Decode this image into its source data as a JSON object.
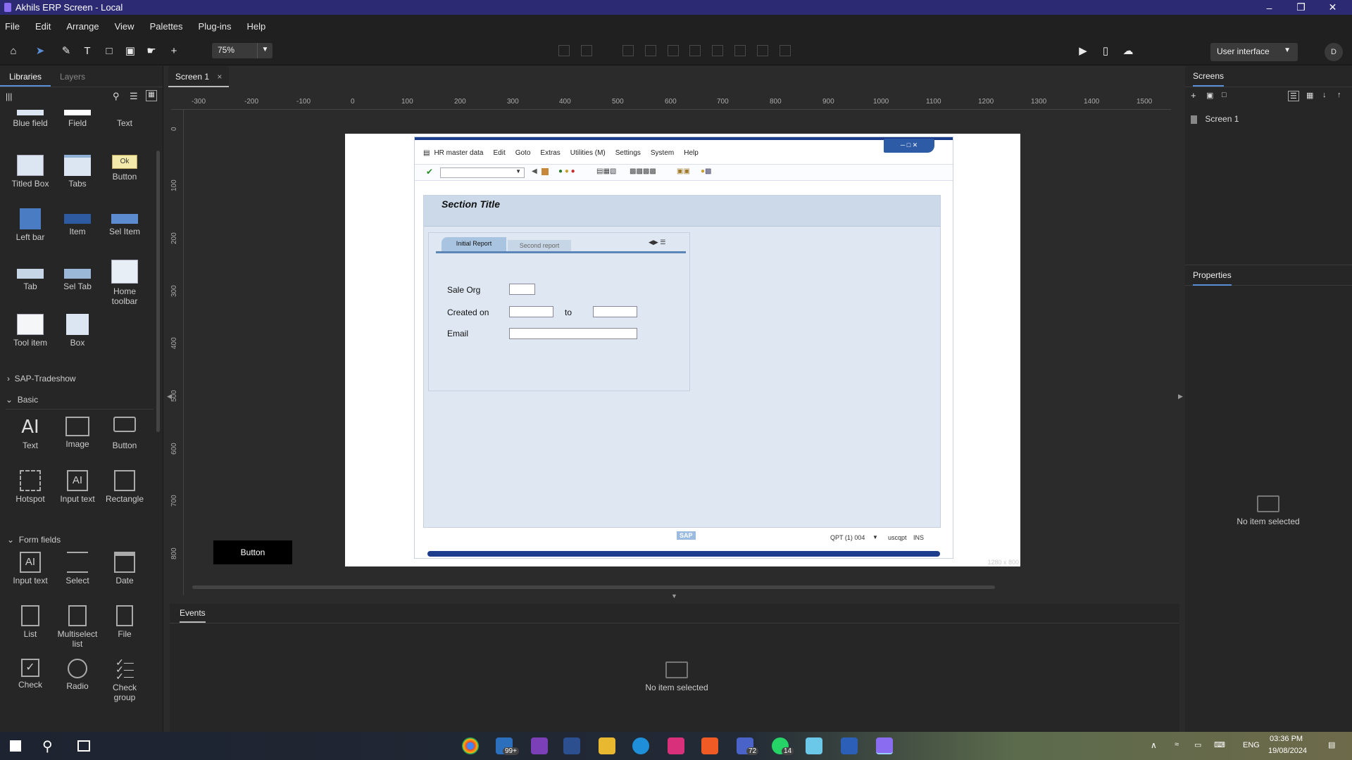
{
  "window": {
    "title": "Akhils ERP Screen - Local"
  },
  "menu": [
    "File",
    "Edit",
    "Arrange",
    "View",
    "Palettes",
    "Plug-ins",
    "Help"
  ],
  "toolbar": {
    "zoom": "75%",
    "mode_dropdown": "User interface",
    "avatar_initial": "D"
  },
  "left_panel": {
    "tabs": [
      "Libraries",
      "Layers"
    ],
    "sap_components": [
      "Blue field",
      "Field",
      "Text",
      "Titled Box",
      "Tabs",
      "Button",
      "Left bar",
      "Item",
      "Sel Item",
      "Tab",
      "Sel Tab",
      "Home toolbar",
      "Tool item",
      "Box"
    ],
    "sections": {
      "sap_tradeshow": "SAP-Tradeshow",
      "basic": "Basic",
      "form_fields": "Form fields"
    },
    "basic_components": [
      "Text",
      "Image",
      "Button",
      "Hotspot",
      "Input text",
      "Rectangle"
    ],
    "form_components": [
      "Input text",
      "Select",
      "Date",
      "List",
      "Multiselect list",
      "File",
      "Check",
      "Radio",
      "Check group"
    ]
  },
  "canvas": {
    "screen_tab": "Screen 1",
    "ruler_h": [
      "-300",
      "-200",
      "-100",
      "0",
      "100",
      "200",
      "300",
      "400",
      "500",
      "600",
      "700",
      "800",
      "900",
      "1000",
      "1100",
      "1200",
      "1300",
      "1400",
      "1500"
    ],
    "ruler_v": [
      "0",
      "100",
      "200",
      "300",
      "400",
      "500",
      "600",
      "700",
      "800"
    ],
    "artboard_size": "1280 x 800",
    "outside_button": "Button"
  },
  "sap": {
    "menu": [
      "HR master data",
      "Edit",
      "Goto",
      "Extras",
      "Utilities (M)",
      "Settings",
      "System",
      "Help"
    ],
    "section_title": "Section Title",
    "tabs": [
      "Initial Report",
      "Second report"
    ],
    "fields": {
      "sale_org": "Sale Org",
      "created_on": "Created on",
      "to": "to",
      "email": "Email"
    },
    "status": {
      "system": "QPT (1) 004",
      "user": "uscqpt",
      "mode": "INS"
    },
    "logo": "SAP"
  },
  "events": {
    "tab": "Events",
    "empty": "No item selected"
  },
  "right_panel": {
    "screens_title": "Screens",
    "screen_item": "Screen 1",
    "properties_title": "Properties",
    "empty": "No item selected"
  },
  "taskbar": {
    "time": "03:36 PM",
    "date": "19/08/2024",
    "lang": "ENG",
    "mail_badge": "99+",
    "teams_badge": "72",
    "whatsapp_badge": "14"
  }
}
